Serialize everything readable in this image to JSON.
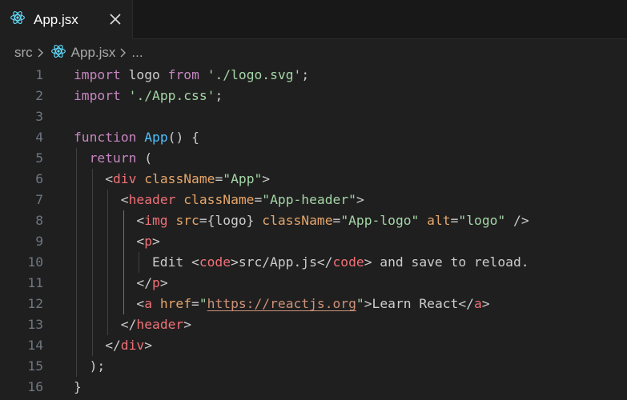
{
  "tab": {
    "label": "App.jsx",
    "icon": "react-icon",
    "close_icon": "close-icon"
  },
  "breadcrumb": {
    "items": [
      "src",
      "App.jsx",
      "..."
    ]
  },
  "colors": {
    "background": "#1f1f1f",
    "keyword": "#c586c0",
    "string": "#98c379",
    "tag": "#f07178",
    "attribute": "#e6a66a",
    "function": "#4fc1ff",
    "react_icon": "#61dafb"
  },
  "editor": {
    "lines": [
      {
        "n": "1",
        "indent": 0,
        "tokens": [
          [
            "kw",
            "import"
          ],
          [
            "plain",
            " logo "
          ],
          [
            "kw",
            "from"
          ],
          [
            "plain",
            " "
          ],
          [
            "green",
            "'./logo.svg'"
          ],
          [
            "plain",
            ";"
          ]
        ]
      },
      {
        "n": "2",
        "indent": 0,
        "tokens": [
          [
            "kw",
            "import"
          ],
          [
            "plain",
            " "
          ],
          [
            "green",
            "'./App.css'"
          ],
          [
            "plain",
            ";"
          ]
        ]
      },
      {
        "n": "3",
        "indent": 0,
        "tokens": []
      },
      {
        "n": "4",
        "indent": 0,
        "tokens": [
          [
            "kw",
            "function"
          ],
          [
            "plain",
            " "
          ],
          [
            "fnb",
            "App"
          ],
          [
            "plain",
            "() {"
          ]
        ]
      },
      {
        "n": "5",
        "indent": 1,
        "tokens": [
          [
            "kw",
            "return"
          ],
          [
            "plain",
            " ("
          ]
        ]
      },
      {
        "n": "6",
        "indent": 2,
        "tokens": [
          [
            "plain",
            "<"
          ],
          [
            "tagc",
            "div"
          ],
          [
            "plain",
            " "
          ],
          [
            "attr",
            "className"
          ],
          [
            "plain",
            "="
          ],
          [
            "green",
            "\"App\""
          ],
          [
            "plain",
            ">"
          ]
        ]
      },
      {
        "n": "7",
        "indent": 3,
        "tokens": [
          [
            "plain",
            "<"
          ],
          [
            "tagc",
            "header"
          ],
          [
            "plain",
            " "
          ],
          [
            "attr",
            "className"
          ],
          [
            "plain",
            "="
          ],
          [
            "green",
            "\"App-header\""
          ],
          [
            "plain",
            ">"
          ]
        ]
      },
      {
        "n": "8",
        "indent": 4,
        "tokens": [
          [
            "plain",
            "<"
          ],
          [
            "tagc",
            "img"
          ],
          [
            "plain",
            " "
          ],
          [
            "attr",
            "src"
          ],
          [
            "plain",
            "={logo} "
          ],
          [
            "attr",
            "className"
          ],
          [
            "plain",
            "="
          ],
          [
            "green",
            "\"App-logo\""
          ],
          [
            "plain",
            " "
          ],
          [
            "attr",
            "alt"
          ],
          [
            "plain",
            "="
          ],
          [
            "green",
            "\"logo\""
          ],
          [
            "plain",
            " />"
          ]
        ]
      },
      {
        "n": "9",
        "indent": 4,
        "tokens": [
          [
            "plain",
            "<"
          ],
          [
            "tagc",
            "p"
          ],
          [
            "plain",
            ">"
          ]
        ]
      },
      {
        "n": "10",
        "indent": 5,
        "tokens": [
          [
            "plain",
            "Edit <"
          ],
          [
            "tagc",
            "code"
          ],
          [
            "plain",
            ">src/App.js</"
          ],
          [
            "tagc",
            "code"
          ],
          [
            "plain",
            "> and save to reload."
          ]
        ]
      },
      {
        "n": "11",
        "indent": 4,
        "tokens": [
          [
            "plain",
            "</"
          ],
          [
            "tagc",
            "p"
          ],
          [
            "plain",
            ">"
          ]
        ]
      },
      {
        "n": "12",
        "indent": 4,
        "tokens": [
          [
            "plain",
            "<"
          ],
          [
            "tagc",
            "a"
          ],
          [
            "plain",
            " "
          ],
          [
            "attr",
            "href"
          ],
          [
            "plain",
            "="
          ],
          [
            "green",
            "\""
          ],
          [
            "link",
            "https://reactjs.org"
          ],
          [
            "green",
            "\""
          ],
          [
            "plain",
            ">Learn React</"
          ],
          [
            "tagc",
            "a"
          ],
          [
            "plain",
            ">"
          ]
        ]
      },
      {
        "n": "13",
        "indent": 3,
        "tokens": [
          [
            "plain",
            "</"
          ],
          [
            "tagc",
            "header"
          ],
          [
            "plain",
            ">"
          ]
        ]
      },
      {
        "n": "14",
        "indent": 2,
        "tokens": [
          [
            "plain",
            "</"
          ],
          [
            "tagc",
            "div"
          ],
          [
            "plain",
            ">"
          ]
        ]
      },
      {
        "n": "15",
        "indent": 1,
        "tokens": [
          [
            "plain",
            ");"
          ]
        ]
      },
      {
        "n": "16",
        "indent": 0,
        "tokens": [
          [
            "plain",
            "}"
          ]
        ]
      }
    ]
  }
}
